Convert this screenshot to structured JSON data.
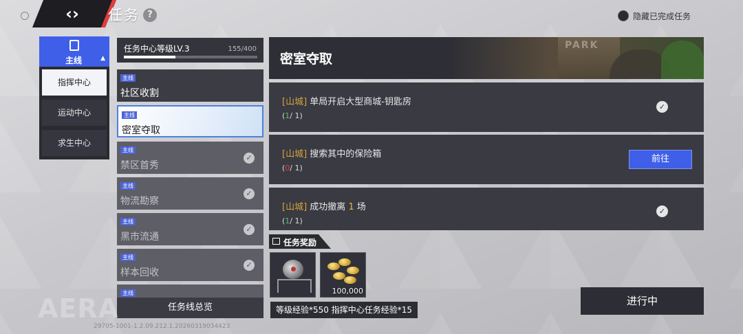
{
  "header": {
    "title": "任务",
    "help_icon": "?",
    "hide_completed_label": "隐藏已完成任务"
  },
  "categories": {
    "main_label": "主线",
    "sub_items": [
      {
        "label": "指挥中心",
        "active": true
      },
      {
        "label": "运动中心",
        "active": false
      },
      {
        "label": "求生中心",
        "active": false
      }
    ]
  },
  "level": {
    "label": "任务中心等级LV.3",
    "progress": "155/400",
    "progress_fraction": 0.3875
  },
  "tasks": [
    {
      "tag": "主线",
      "name": "社区收割",
      "state": "normal"
    },
    {
      "tag": "主线",
      "name": "密室夺取",
      "state": "active"
    },
    {
      "tag": "主线",
      "name": "禁区首秀",
      "state": "done"
    },
    {
      "tag": "主线",
      "name": "物流勘察",
      "state": "done"
    },
    {
      "tag": "主线",
      "name": "黑市流通",
      "state": "done"
    },
    {
      "tag": "主线",
      "name": "样本回收",
      "state": "done"
    },
    {
      "tag": "主线",
      "name": "",
      "state": "done"
    }
  ],
  "overview_button": "任务线总览",
  "detail": {
    "title": "密室夺取",
    "banner_sign": "PARK",
    "objectives": [
      {
        "tag": "[山城]",
        "text": "单局开启大型商城-钥匙房",
        "highlight": "",
        "suffix": "",
        "current": "1",
        "total": "1",
        "done": true
      },
      {
        "tag": "[山城]",
        "text": "搜索其中的保险箱",
        "highlight": "",
        "suffix": "",
        "current": "0",
        "total": "1",
        "done": false,
        "button": "前往"
      },
      {
        "tag": "[山城]",
        "text": "成功撤离",
        "highlight": "1",
        "suffix": "场",
        "current": "1",
        "total": "1",
        "done": true
      }
    ]
  },
  "rewards": {
    "label": "任务奖励",
    "items": [
      {
        "icon": "robot-icon",
        "amount": ""
      },
      {
        "icon": "coins-icon",
        "amount": "100,000"
      }
    ],
    "summary": "等级经验*550  指挥中心任务经验*15"
  },
  "status_button": "进行中",
  "logo_text": "AERA",
  "version": "29705-1001-1.2.09.212.1.20260319034423",
  "colors": {
    "accent_blue": "#3f5fe8",
    "back_red": "#e23c3c",
    "done_green": "#55c46a",
    "todo_red": "#e04444",
    "tag_gold": "#d6a53b"
  }
}
